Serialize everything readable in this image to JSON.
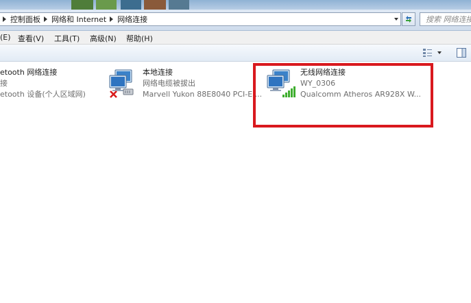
{
  "address_bar": {
    "crumbs": [
      "控制面板",
      "网络和 Internet",
      "网络连接"
    ],
    "search_placeholder": "搜索 网络连接"
  },
  "menu": {
    "items": [
      "(E)",
      "查看(V)",
      "工具(T)",
      "高级(N)",
      "帮助(H)"
    ]
  },
  "connections": [
    {
      "name": "etooth 网络连接",
      "status": "接",
      "device": "etooth 设备(个人区域网)",
      "icon": "bluetooth-network-icon"
    },
    {
      "name": "本地连接",
      "status": "网络电缆被拔出",
      "device": "Marvell Yukon 88E8040 PCI-E ...",
      "icon": "wired-network-disconnected-icon"
    },
    {
      "name": "无线网络连接",
      "status": "WY_0306",
      "device": "Qualcomm Atheros AR928X W...",
      "icon": "wireless-network-icon"
    }
  ],
  "colors": {
    "highlight": "#d9191e",
    "signal": "#3fae2f",
    "error": "#d81b1b"
  }
}
